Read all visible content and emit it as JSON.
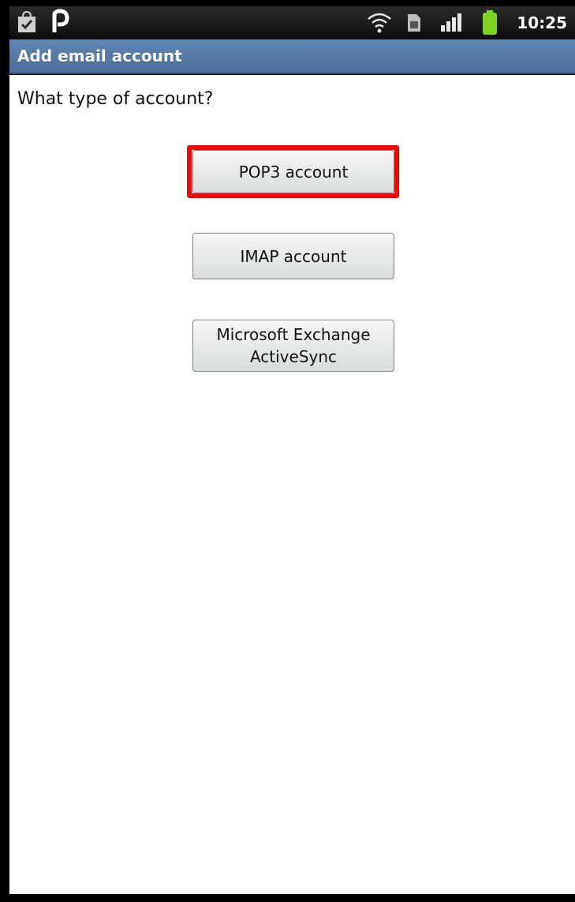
{
  "status_bar": {
    "left_icons": [
      "shopping-bag-icon",
      "p-app-icon"
    ],
    "right_icons": [
      "wifi-icon",
      "sim-icon",
      "signal-icon",
      "battery-icon"
    ],
    "time": "10:25"
  },
  "title_bar": {
    "title": "Add email account"
  },
  "main": {
    "prompt": "What type of account?",
    "buttons": [
      {
        "label": "POP3 account",
        "highlighted": true
      },
      {
        "label": "IMAP account"
      },
      {
        "label": "Microsoft Exchange\nActiveSync"
      }
    ]
  },
  "colors": {
    "title_bar": "#5679a6",
    "highlight": "#ff0000",
    "battery": "#7ed321"
  }
}
